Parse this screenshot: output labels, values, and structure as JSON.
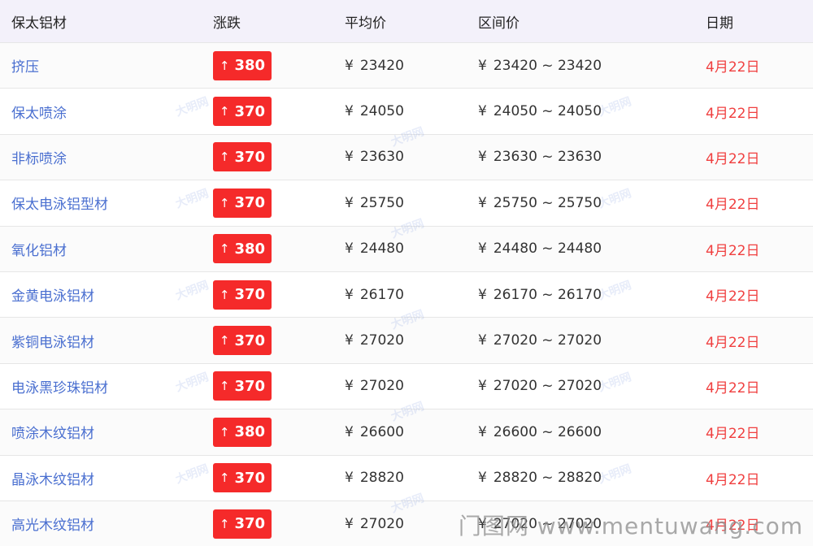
{
  "headers": {
    "name": "保太铝材",
    "change": "涨跌",
    "avg": "平均价",
    "range": "区间价",
    "date": "日期"
  },
  "currency": "¥",
  "rows": [
    {
      "name": "挤压",
      "change": "380",
      "avg": "23420",
      "range": "23420 ~ 23420",
      "date": "4月22日"
    },
    {
      "name": "保太喷涂",
      "change": "370",
      "avg": "24050",
      "range": "24050 ~ 24050",
      "date": "4月22日"
    },
    {
      "name": "非标喷涂",
      "change": "370",
      "avg": "23630",
      "range": "23630 ~ 23630",
      "date": "4月22日"
    },
    {
      "name": "保太电泳铝型材",
      "change": "370",
      "avg": "25750",
      "range": "25750 ~ 25750",
      "date": "4月22日"
    },
    {
      "name": "氧化铝材",
      "change": "380",
      "avg": "24480",
      "range": "24480 ~ 24480",
      "date": "4月22日"
    },
    {
      "name": "金黄电泳铝材",
      "change": "370",
      "avg": "26170",
      "range": "26170 ~ 26170",
      "date": "4月22日"
    },
    {
      "name": "紫铜电泳铝材",
      "change": "370",
      "avg": "27020",
      "range": "27020 ~ 27020",
      "date": "4月22日"
    },
    {
      "name": "电泳黑珍珠铝材",
      "change": "370",
      "avg": "27020",
      "range": "27020 ~ 27020",
      "date": "4月22日"
    },
    {
      "name": "喷涂木纹铝材",
      "change": "380",
      "avg": "26600",
      "range": "26600 ~ 26600",
      "date": "4月22日"
    },
    {
      "name": "晶泳木纹铝材",
      "change": "370",
      "avg": "28820",
      "range": "28820 ~ 28820",
      "date": "4月22日"
    },
    {
      "name": "高光木纹铝材",
      "change": "370",
      "avg": "27020",
      "range": "27020 ~ 27020",
      "date": "4月22日"
    }
  ],
  "arrow_icon": "up-arrow-icon",
  "watermark_text": "大明网",
  "footer_watermark": "门图网 www.mentuwang.com",
  "colors": {
    "header_bg": "#f3f1fa",
    "name_link": "#4a6fd0",
    "badge_bg": "#f52a2a",
    "date": "#f04040"
  }
}
